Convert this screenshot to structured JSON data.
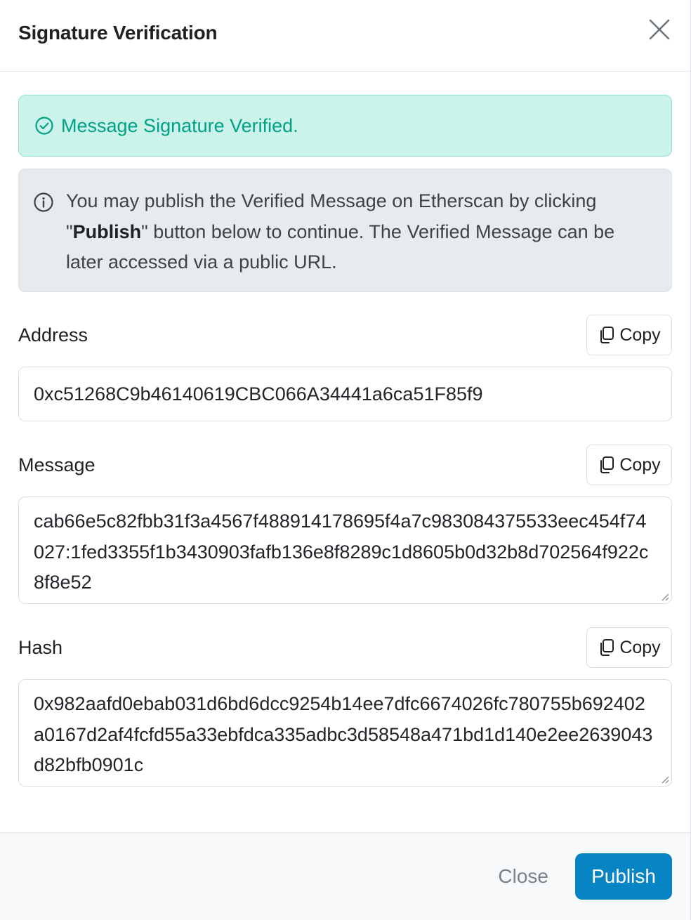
{
  "dialog": {
    "title": "Signature Verification"
  },
  "alerts": {
    "success": "Message Signature Verified.",
    "info_pre": "You may publish the Verified Message on Etherscan by clicking \"",
    "info_bold": "Publish",
    "info_post": "\" button below to continue. The Verified Message can be later accessed via a public URL."
  },
  "fields": {
    "address": {
      "label": "Address",
      "copy_label": "Copy",
      "value": "0xc51268C9b46140619CBC066A34441a6ca51F85f9"
    },
    "message": {
      "label": "Message",
      "copy_label": "Copy",
      "value": "cab66e5c82fbb31f3a4567f488914178695f4a7c983084375533eec454f74027:1fed3355f1b3430903fafb136e8f8289c1d8605b0d32b8d702564f922c8f8e52"
    },
    "hash": {
      "label": "Hash",
      "copy_label": "Copy",
      "value": "0x982aafd0ebab031d6bd6dcc9254b14ee7dfc6674026fc780755b692402a0167d2af4fcfd55a33ebfdca335adbc3d58548a471bd1d140e2ee2639043d82bfb0901c"
    }
  },
  "footer": {
    "close_label": "Close",
    "publish_label": "Publish"
  },
  "colors": {
    "success_text": "#00a186",
    "success_bg": "#cbf3ea",
    "info_bg": "#e8ebee",
    "primary": "#0784c3",
    "muted": "#77838f"
  },
  "icons": {
    "close": "close-icon",
    "success": "check-circle-icon",
    "info": "info-circle-icon",
    "copy": "copy-icon"
  }
}
